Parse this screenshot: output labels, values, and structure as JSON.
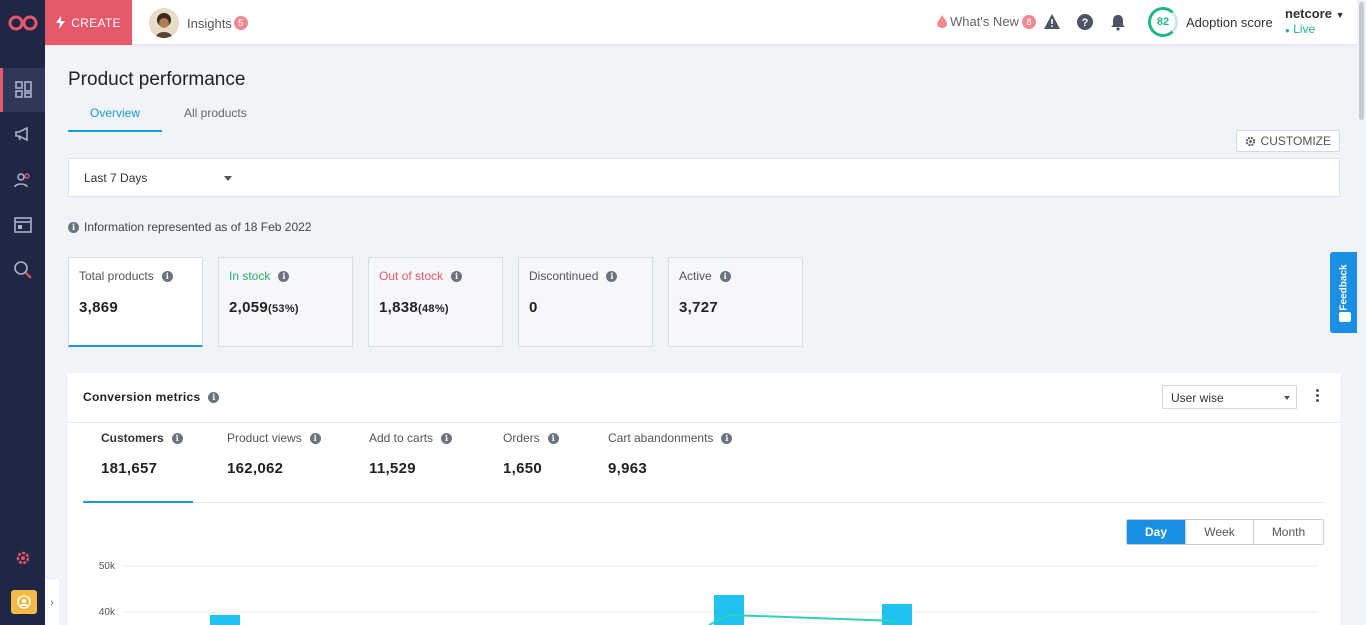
{
  "topbar": {
    "create_label": "CREATE",
    "insights_label": "Insights",
    "insights_badge": "5",
    "whats_new_label": "What's New",
    "whats_new_badge": "8",
    "adoption_score": "82",
    "adoption_label": "Adoption score",
    "account_name": "netcore",
    "account_status": "Live"
  },
  "page": {
    "title": "Product performance",
    "tabs": [
      {
        "label": "Overview",
        "active": true
      },
      {
        "label": "All products",
        "active": false
      }
    ],
    "customize_label": "CUSTOMIZE",
    "date_range": "Last 7 Days",
    "info_text": "Information represented as of 18 Feb 2022"
  },
  "stats": [
    {
      "label": "Total products",
      "value": "3,869",
      "pct": "",
      "color": "#555555"
    },
    {
      "label": "In stock",
      "value": "2,059",
      "pct": "(53%)",
      "color": "#2eab6e"
    },
    {
      "label": "Out of stock",
      "value": "1,838",
      "pct": "(48%)",
      "color": "#e5596a"
    },
    {
      "label": "Discontinued",
      "value": "0",
      "pct": "",
      "color": "#555555"
    },
    {
      "label": "Active",
      "value": "3,727",
      "pct": "",
      "color": "#555555"
    }
  ],
  "conversion": {
    "title": "Conversion metrics",
    "view_select": "User wise",
    "metrics": [
      {
        "label": "Customers",
        "value": "181,657"
      },
      {
        "label": "Product views",
        "value": "162,062"
      },
      {
        "label": "Add to carts",
        "value": "11,529"
      },
      {
        "label": "Orders",
        "value": "1,650"
      },
      {
        "label": "Cart abandonments",
        "value": "9,963"
      }
    ],
    "ranges": [
      "Day",
      "Week",
      "Month"
    ],
    "y_ticks": [
      "50k",
      "40k"
    ]
  },
  "feedback_label": "Feedback",
  "colors": {
    "sidebar": "#1f2744",
    "accent": "#e5596a",
    "primary": "#1a8fe3",
    "success": "#1fb78a"
  }
}
